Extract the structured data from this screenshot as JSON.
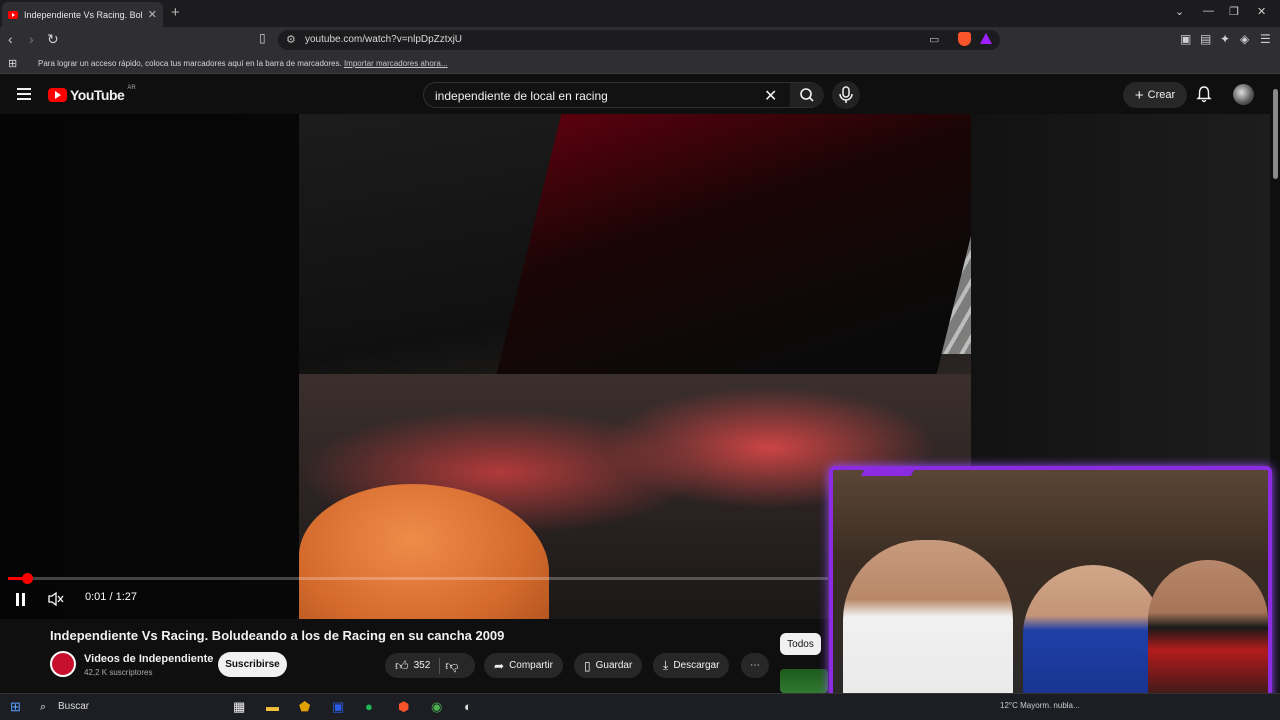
{
  "browser": {
    "tab_title": "Independiente Vs Racing. Bolude",
    "url": "youtube.com/watch?v=nlpDpZztxjU",
    "bookmarks_message": "Para lograr un acceso rápido, coloca tus marcadores aquí en la barra de marcadores.",
    "bookmarks_link": "Importar marcadores ahora..."
  },
  "youtube": {
    "logo_text": "YouTube",
    "country": "AR",
    "search_query": "independiente de local en racing",
    "create_label": "Crear"
  },
  "player": {
    "time": "0:01 / 1:27",
    "progress_fraction": 0.0115
  },
  "video": {
    "title": "Independiente Vs Racing. Boludeando a los de Racing en su cancha 2009",
    "channel": "Videos de Independiente",
    "subscribers": "42,2 K suscriptores",
    "subscribe_label": "Suscribirse",
    "likes": "352",
    "share_label": "Compartir",
    "save_label": "Guardar",
    "download_label": "Descargar",
    "filter_chip": "Todos"
  },
  "taskbar": {
    "search_label": "Buscar",
    "tray_text": "12°C  Mayorm. nubla..."
  },
  "colors": {
    "accent": "#ff0000",
    "overlay_border": "#8b2be2",
    "background": "#0f0f0f"
  }
}
